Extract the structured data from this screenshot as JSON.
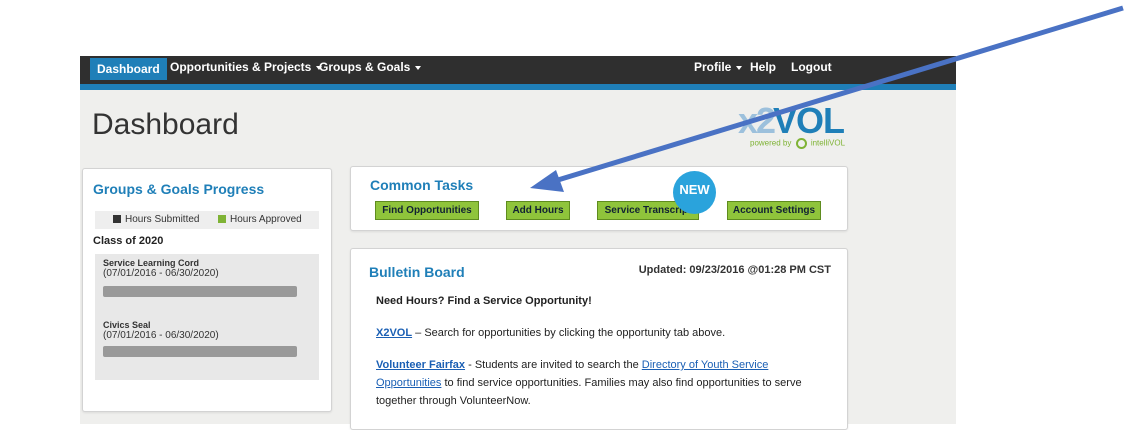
{
  "nav": {
    "dashboard": "Dashboard",
    "opportunities": "Opportunities & Projects",
    "groups": "Groups & Goals",
    "profile": "Profile",
    "help": "Help",
    "logout": "Logout"
  },
  "page": {
    "title": "Dashboard"
  },
  "logo": {
    "x2": "x2",
    "vol": "VOL",
    "powered": "powered by",
    "brand": "intelliVOL"
  },
  "groups_goals": {
    "title": "Groups & Goals Progress",
    "legend_submitted": "Hours Submitted",
    "legend_approved": "Hours Approved",
    "class_label": "Class of 2020",
    "goals": [
      {
        "name": "Service Learning Cord",
        "dates": "(07/01/2016 - 06/30/2020)",
        "approved_fraction": 0
      },
      {
        "name": "Civics Seal",
        "dates": "(07/01/2016 - 06/30/2020)",
        "approved_fraction": 0
      }
    ]
  },
  "common_tasks": {
    "title": "Common Tasks",
    "buttons": [
      "Find Opportunities",
      "Add Hours",
      "Service Transcript",
      "Account Settings"
    ],
    "badge": "NEW"
  },
  "bulletin": {
    "title": "Bulletin Board",
    "updated": "Updated: 09/23/2016 @01:28 PM CST",
    "headline": "Need Hours? Find a Service Opportunity!",
    "x2vol_link": "X2VOL",
    "x2vol_text": "– Search for opportunities by clicking the opportunity tab above.",
    "vf_link": "Volunteer Fairfax",
    "vf_text1": "- Students are invited to search the",
    "dir_link_1": "Directory of Youth Service",
    "dir_link_2": "Opportunities",
    "vf_text2": "to find service opportunities. Families may also find opportunities to serve",
    "vf_text3": "together through VolunteerNow."
  },
  "colors": {
    "accent": "#1f7fb8",
    "button": "#8fc43b",
    "navbar": "#2f2f2f",
    "arrow": "#4a72c4"
  }
}
